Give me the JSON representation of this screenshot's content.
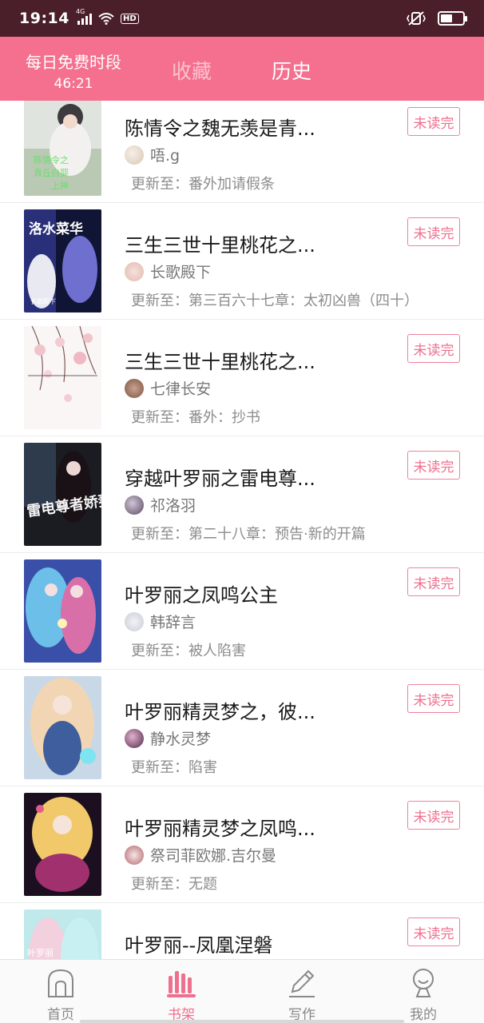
{
  "status_bar": {
    "time": "19:14",
    "network": "4G",
    "hd": "HD",
    "battery_level": 0.55
  },
  "header": {
    "free_title": "每日免费时段",
    "free_timer": "46:21",
    "tabs": [
      {
        "label": "收藏",
        "active": false
      },
      {
        "label": "历史",
        "active": true
      }
    ]
  },
  "books": [
    {
      "title": "陈情令之魏无羡是青...",
      "author": "唔.g",
      "update": "更新至：番外加请假条",
      "status": "未读完"
    },
    {
      "title": "三生三世十里桃花之...",
      "author": "长歌殿下",
      "update": "更新至：第三百六十七章：太初凶兽（四十）",
      "status": "未读完"
    },
    {
      "title": "三生三世十里桃花之...",
      "author": "七律长安",
      "update": "更新至：番外：抄书",
      "status": "未读完"
    },
    {
      "title": "穿越叶罗丽之雷电尊...",
      "author": "祁洛羽",
      "update": "更新至：第二十八章：预告·新的开篇",
      "status": "未读完"
    },
    {
      "title": "叶罗丽之凤鸣公主",
      "author": "韩辞言",
      "update": "更新至：被人陷害",
      "status": "未读完"
    },
    {
      "title": "叶罗丽精灵梦之，彼...",
      "author": "静水灵梦",
      "update": "更新至：陷害",
      "status": "未读完"
    },
    {
      "title": "叶罗丽精灵梦之凤鸣...",
      "author": "祭司菲欧娜.吉尔曼",
      "update": "更新至：无题",
      "status": "未读完"
    },
    {
      "title": "叶罗丽--凤凰涅磐",
      "author": "",
      "update": "",
      "status": "未读完"
    }
  ],
  "covers": {
    "c1": {
      "lines": [
        "陈情令之",
        "青丘白婴",
        "上神"
      ]
    },
    "c2": {
      "big": "洛水菜华",
      "small": "长歌殿下"
    },
    "c4": {
      "big": "雷电尊者娇妻"
    },
    "c8": {
      "big": "叶罗丽"
    }
  },
  "nav": [
    {
      "label": "首页",
      "icon": "home-icon",
      "active": false
    },
    {
      "label": "书架",
      "icon": "bookshelf-icon",
      "active": true
    },
    {
      "label": "写作",
      "icon": "pen-icon",
      "active": false
    },
    {
      "label": "我的",
      "icon": "profile-icon",
      "active": false
    }
  ],
  "colors": {
    "accent": "#f4708e",
    "status_bar": "#4a1f29",
    "unread": "#ef6f8e"
  }
}
